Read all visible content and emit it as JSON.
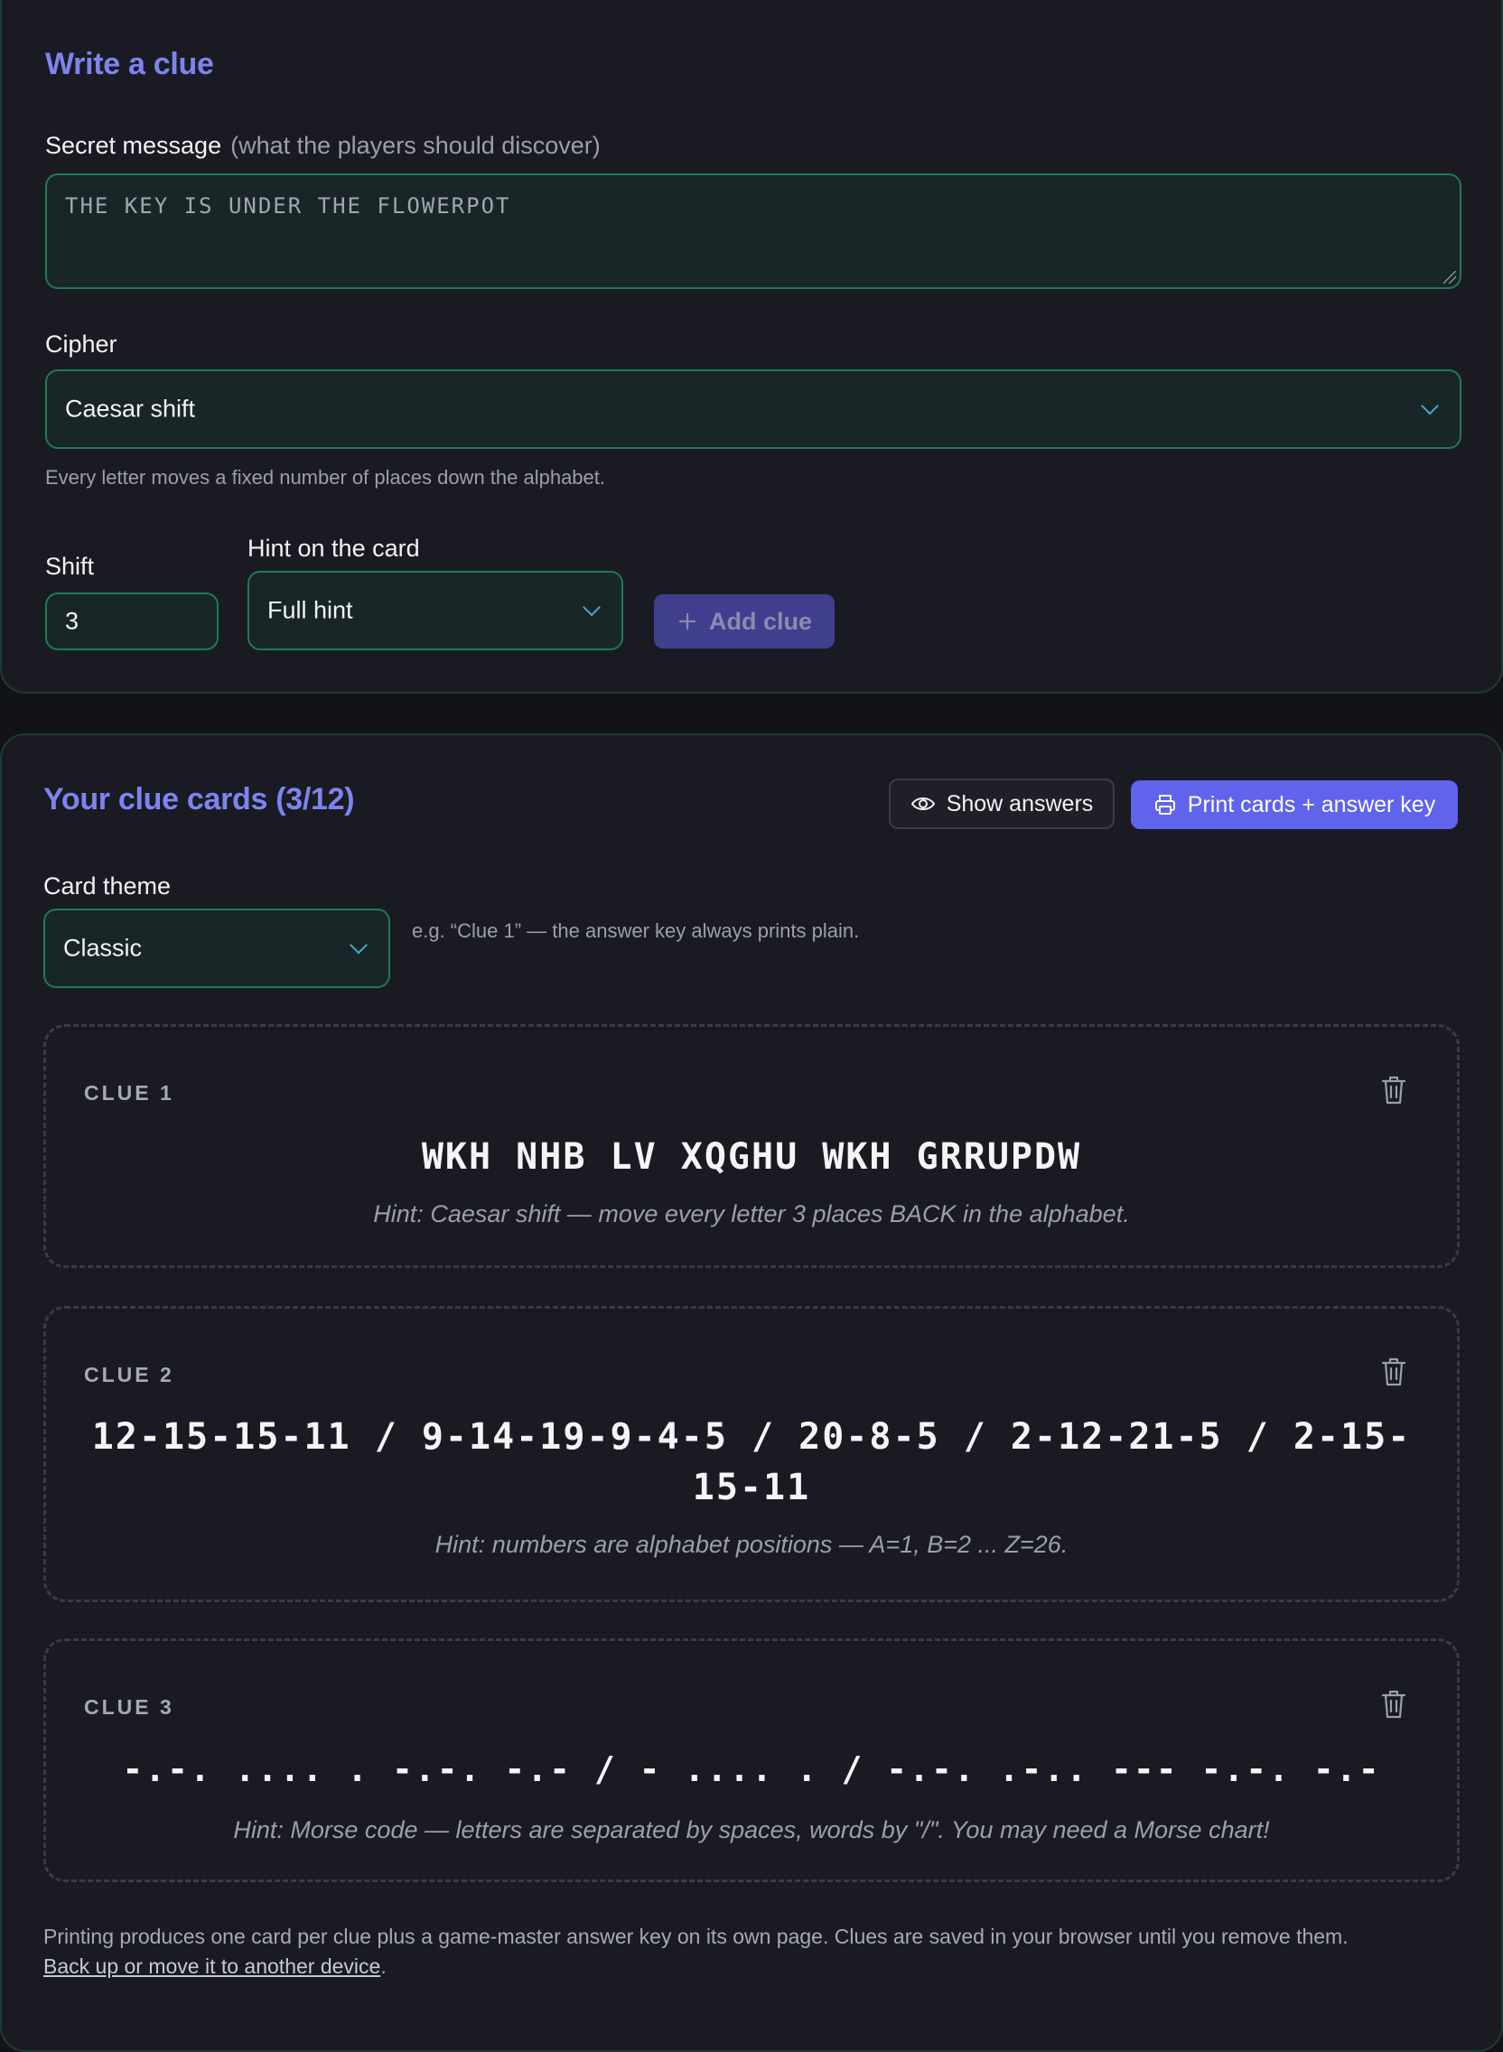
{
  "writer": {
    "title": "Write a clue",
    "secret_label": "Secret message",
    "secret_sub": "(what the players should discover)",
    "secret_value": "THE KEY IS UNDER THE FLOWERPOT",
    "cipher_label": "Cipher",
    "cipher_value": "Caesar shift",
    "cipher_help": "Every letter moves a fixed number of places down the alphabet.",
    "shift_label": "Shift",
    "shift_value": "3",
    "hint_label": "Hint on the card",
    "hint_value": "Full hint",
    "add_label": "Add clue"
  },
  "cards": {
    "title": "Your clue cards (3/12)",
    "show_answers": "Show answers",
    "print_label": "Print cards + answer key",
    "theme_label": "Card theme",
    "theme_value": "Classic",
    "theme_help": "e.g. “Clue 1” — the answer key always prints plain.",
    "clues": [
      {
        "title": "CLUE 1",
        "cipher": "WKH NHB LV XQGHU WKH GRRUPDW",
        "hint": "Hint: Caesar shift — move every letter 3 places BACK in the alphabet."
      },
      {
        "title": "CLUE 2",
        "cipher": "12-15-15-11 / 9-14-19-9-4-5 / 20-8-5 / 2-12-21-5 / 2-15-15-11",
        "hint": "Hint: numbers are alphabet positions — A=1, B=2 ... Z=26."
      },
      {
        "title": "CLUE 3",
        "cipher": "-.-. .... . -.-. -.- / - .... . / -.-. .-.. --- -.-. -.-",
        "hint": "Hint: Morse code — letters are separated by spaces, words by \"/\". You may need a Morse chart!"
      }
    ]
  },
  "footer": {
    "text": "Printing produces one card per clue plus a game-master answer key on its own page. Clues are saved in your browser until you remove them.",
    "link": "Back up or move it to another device",
    "end": "."
  },
  "colors": {
    "accent": "#7d84f0",
    "primary_button": "#6063ec",
    "field_border": "#1f7a54",
    "chevron": "#4aa8d4"
  }
}
